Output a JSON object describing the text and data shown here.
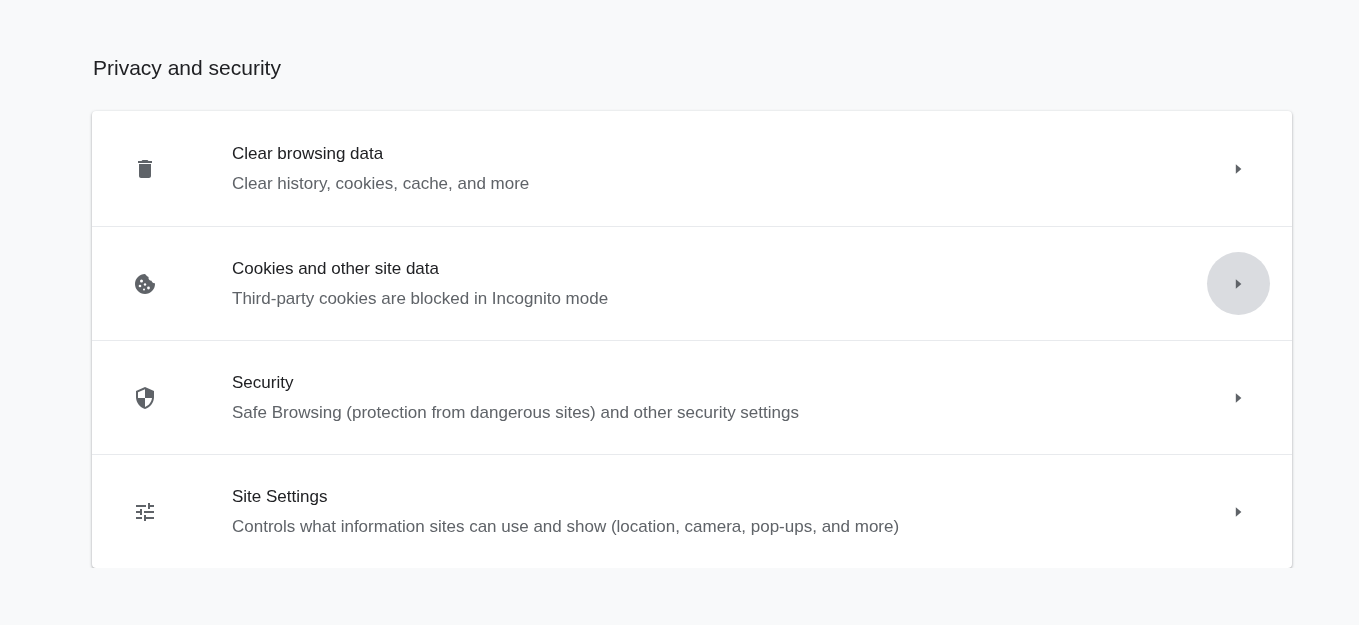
{
  "section": {
    "title": "Privacy and security"
  },
  "items": [
    {
      "title": "Clear browsing data",
      "subtitle": "Clear history, cookies, cache, and more",
      "hovered": false
    },
    {
      "title": "Cookies and other site data",
      "subtitle": "Third-party cookies are blocked in Incognito mode",
      "hovered": true
    },
    {
      "title": "Security",
      "subtitle": "Safe Browsing (protection from dangerous sites) and other security settings",
      "hovered": false
    },
    {
      "title": "Site Settings",
      "subtitle": "Controls what information sites can use and show (location, camera, pop-ups, and more)",
      "hovered": false
    }
  ]
}
